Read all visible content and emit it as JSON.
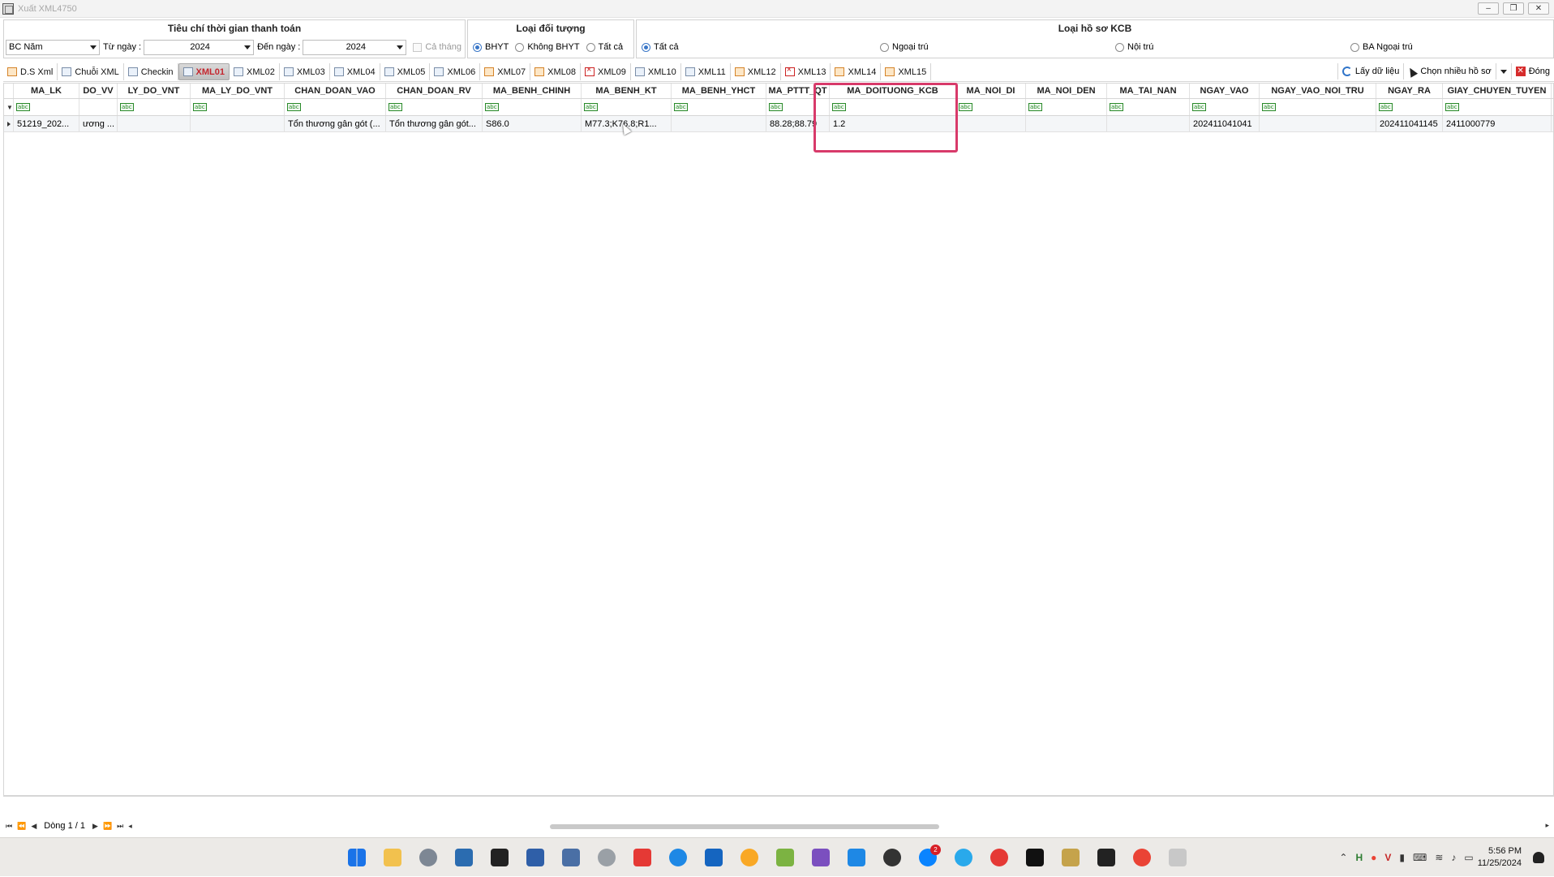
{
  "window": {
    "title": "Xuất XML4750"
  },
  "criteria": {
    "time_group": {
      "title": "Tiêu chí thời gian thanh toán",
      "report_type": "BC Năm",
      "from_label": "Từ ngày :",
      "from_value": "2024",
      "to_label": "Đến ngày :",
      "to_value": "2024",
      "full_month_label": "Cả tháng"
    },
    "subject_group": {
      "title": "Loại đối tượng",
      "options": [
        "BHYT",
        "Không BHYT",
        "Tất cả"
      ],
      "selected": "BHYT"
    },
    "record_group": {
      "title": "Loại hồ sơ KCB",
      "options": [
        "Tất cả",
        "Ngoại trú",
        "Nội trú",
        "BA Ngoại trú"
      ],
      "selected": "Tất cả"
    }
  },
  "tabs": [
    "D.S Xml",
    "Chuỗi XML",
    "Checkin",
    "XML01",
    "XML02",
    "XML03",
    "XML04",
    "XML05",
    "XML06",
    "XML07",
    "XML08",
    "XML09",
    "XML10",
    "XML11",
    "XML12",
    "XML13",
    "XML14",
    "XML15"
  ],
  "active_tab": "XML01",
  "actions": {
    "fetch": "Lấy dữ liệu",
    "multi_select": "Chọn nhiều hồ sơ",
    "close": "Đóng"
  },
  "grid": {
    "columns": [
      "MA_LK",
      "DO_VV",
      "LY_DO_VNT",
      "MA_LY_DO_VNT",
      "CHAN_DOAN_VAO",
      "CHAN_DOAN_RV",
      "MA_BENH_CHINH",
      "MA_BENH_KT",
      "MA_BENH_YHCT",
      "MA_PTTT_QT",
      "MA_DOITUONG_KCB",
      "MA_NOI_DI",
      "MA_NOI_DEN",
      "MA_TAI_NAN",
      "NGAY_VAO",
      "NGAY_VAO_NOI_TRU",
      "NGAY_RA",
      "GIAY_CHUYEN_TUYEN"
    ],
    "filter_icon": "abc",
    "rows": [
      [
        "51219_202...",
        "ương ...",
        "",
        "",
        "Tổn thương gân gót (...",
        "Tổn thương gân gót...",
        "S86.0",
        "M77.3;K76.8;R1...",
        "",
        "88.28;88.79",
        "1.2",
        "",
        "",
        "",
        "202411041041",
        "",
        "202411041145",
        "2411000779"
      ]
    ]
  },
  "navigator": {
    "record_label": "Dòng 1 / 1"
  },
  "taskbar": {
    "zalo_badge": "2",
    "time": "5:56 PM",
    "date": "11/25/2024"
  },
  "colors": {
    "highlight": "#d83a6a",
    "active_tab_text": "#c4262e"
  }
}
